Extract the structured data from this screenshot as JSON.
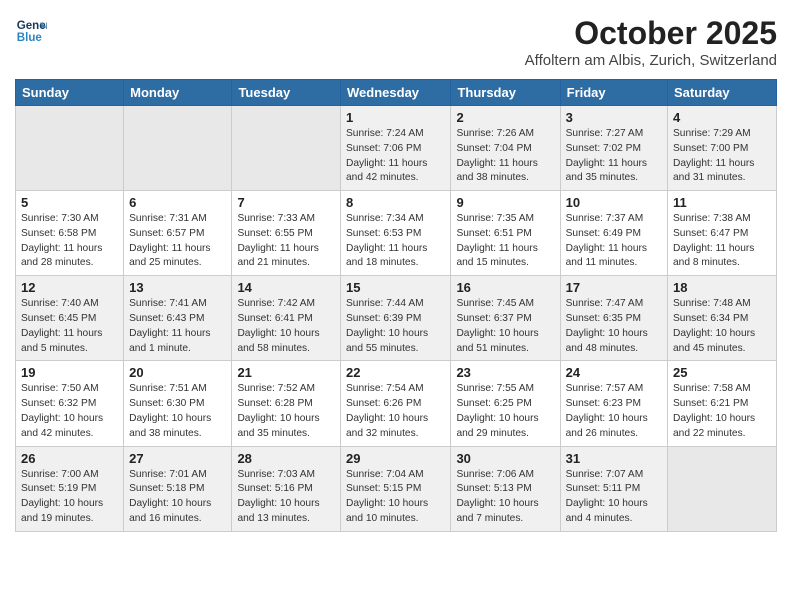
{
  "header": {
    "logo_line1": "General",
    "logo_line2": "Blue",
    "month": "October 2025",
    "location": "Affoltern am Albis, Zurich, Switzerland"
  },
  "days_of_week": [
    "Sunday",
    "Monday",
    "Tuesday",
    "Wednesday",
    "Thursday",
    "Friday",
    "Saturday"
  ],
  "weeks": [
    [
      {
        "day": "",
        "info": ""
      },
      {
        "day": "",
        "info": ""
      },
      {
        "day": "",
        "info": ""
      },
      {
        "day": "1",
        "info": "Sunrise: 7:24 AM\nSunset: 7:06 PM\nDaylight: 11 hours\nand 42 minutes."
      },
      {
        "day": "2",
        "info": "Sunrise: 7:26 AM\nSunset: 7:04 PM\nDaylight: 11 hours\nand 38 minutes."
      },
      {
        "day": "3",
        "info": "Sunrise: 7:27 AM\nSunset: 7:02 PM\nDaylight: 11 hours\nand 35 minutes."
      },
      {
        "day": "4",
        "info": "Sunrise: 7:29 AM\nSunset: 7:00 PM\nDaylight: 11 hours\nand 31 minutes."
      }
    ],
    [
      {
        "day": "5",
        "info": "Sunrise: 7:30 AM\nSunset: 6:58 PM\nDaylight: 11 hours\nand 28 minutes."
      },
      {
        "day": "6",
        "info": "Sunrise: 7:31 AM\nSunset: 6:57 PM\nDaylight: 11 hours\nand 25 minutes."
      },
      {
        "day": "7",
        "info": "Sunrise: 7:33 AM\nSunset: 6:55 PM\nDaylight: 11 hours\nand 21 minutes."
      },
      {
        "day": "8",
        "info": "Sunrise: 7:34 AM\nSunset: 6:53 PM\nDaylight: 11 hours\nand 18 minutes."
      },
      {
        "day": "9",
        "info": "Sunrise: 7:35 AM\nSunset: 6:51 PM\nDaylight: 11 hours\nand 15 minutes."
      },
      {
        "day": "10",
        "info": "Sunrise: 7:37 AM\nSunset: 6:49 PM\nDaylight: 11 hours\nand 11 minutes."
      },
      {
        "day": "11",
        "info": "Sunrise: 7:38 AM\nSunset: 6:47 PM\nDaylight: 11 hours\nand 8 minutes."
      }
    ],
    [
      {
        "day": "12",
        "info": "Sunrise: 7:40 AM\nSunset: 6:45 PM\nDaylight: 11 hours\nand 5 minutes."
      },
      {
        "day": "13",
        "info": "Sunrise: 7:41 AM\nSunset: 6:43 PM\nDaylight: 11 hours\nand 1 minute."
      },
      {
        "day": "14",
        "info": "Sunrise: 7:42 AM\nSunset: 6:41 PM\nDaylight: 10 hours\nand 58 minutes."
      },
      {
        "day": "15",
        "info": "Sunrise: 7:44 AM\nSunset: 6:39 PM\nDaylight: 10 hours\nand 55 minutes."
      },
      {
        "day": "16",
        "info": "Sunrise: 7:45 AM\nSunset: 6:37 PM\nDaylight: 10 hours\nand 51 minutes."
      },
      {
        "day": "17",
        "info": "Sunrise: 7:47 AM\nSunset: 6:35 PM\nDaylight: 10 hours\nand 48 minutes."
      },
      {
        "day": "18",
        "info": "Sunrise: 7:48 AM\nSunset: 6:34 PM\nDaylight: 10 hours\nand 45 minutes."
      }
    ],
    [
      {
        "day": "19",
        "info": "Sunrise: 7:50 AM\nSunset: 6:32 PM\nDaylight: 10 hours\nand 42 minutes."
      },
      {
        "day": "20",
        "info": "Sunrise: 7:51 AM\nSunset: 6:30 PM\nDaylight: 10 hours\nand 38 minutes."
      },
      {
        "day": "21",
        "info": "Sunrise: 7:52 AM\nSunset: 6:28 PM\nDaylight: 10 hours\nand 35 minutes."
      },
      {
        "day": "22",
        "info": "Sunrise: 7:54 AM\nSunset: 6:26 PM\nDaylight: 10 hours\nand 32 minutes."
      },
      {
        "day": "23",
        "info": "Sunrise: 7:55 AM\nSunset: 6:25 PM\nDaylight: 10 hours\nand 29 minutes."
      },
      {
        "day": "24",
        "info": "Sunrise: 7:57 AM\nSunset: 6:23 PM\nDaylight: 10 hours\nand 26 minutes."
      },
      {
        "day": "25",
        "info": "Sunrise: 7:58 AM\nSunset: 6:21 PM\nDaylight: 10 hours\nand 22 minutes."
      }
    ],
    [
      {
        "day": "26",
        "info": "Sunrise: 7:00 AM\nSunset: 5:19 PM\nDaylight: 10 hours\nand 19 minutes."
      },
      {
        "day": "27",
        "info": "Sunrise: 7:01 AM\nSunset: 5:18 PM\nDaylight: 10 hours\nand 16 minutes."
      },
      {
        "day": "28",
        "info": "Sunrise: 7:03 AM\nSunset: 5:16 PM\nDaylight: 10 hours\nand 13 minutes."
      },
      {
        "day": "29",
        "info": "Sunrise: 7:04 AM\nSunset: 5:15 PM\nDaylight: 10 hours\nand 10 minutes."
      },
      {
        "day": "30",
        "info": "Sunrise: 7:06 AM\nSunset: 5:13 PM\nDaylight: 10 hours\nand 7 minutes."
      },
      {
        "day": "31",
        "info": "Sunrise: 7:07 AM\nSunset: 5:11 PM\nDaylight: 10 hours\nand 4 minutes."
      },
      {
        "day": "",
        "info": ""
      }
    ]
  ]
}
